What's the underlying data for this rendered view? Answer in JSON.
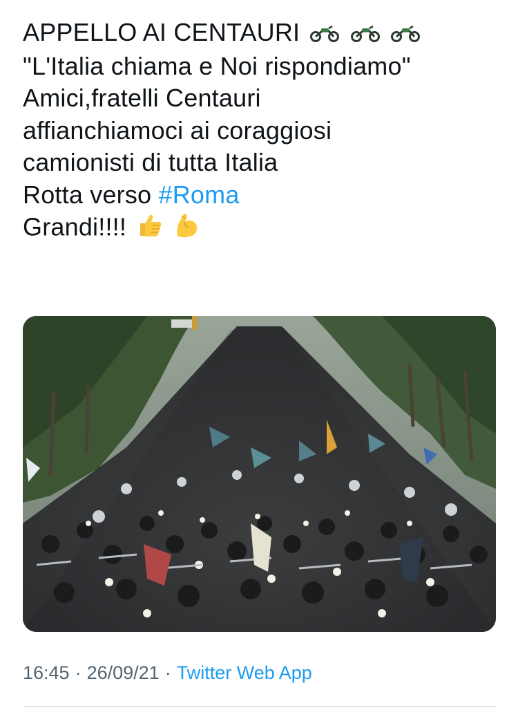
{
  "tweet": {
    "lines": [
      "APPELLO AI CENTAURI",
      "\"L'Italia chiama e Noi rispondiamo\"",
      "Amici,fratelli Centauri",
      "affianchiamoci ai coraggiosi",
      "camionisti di tutta Italia",
      "Rotta verso "
    ],
    "hashtag": "#Roma",
    "closing": "Grandi!!!!",
    "emoji_motorbike": "🏍",
    "emoji_thumbs_up": "👍",
    "emoji_flexed_bicep": "💪"
  },
  "media": {
    "icon": "photo-motorcycle-rally",
    "alt": ""
  },
  "meta": {
    "time": "16:45",
    "date": "26/09/21",
    "separator": "·",
    "source": "Twitter Web App"
  },
  "colors": {
    "text": "#0f1419",
    "link": "#1d9bf0",
    "secondary": "#536471",
    "divider": "#cfd9de"
  }
}
